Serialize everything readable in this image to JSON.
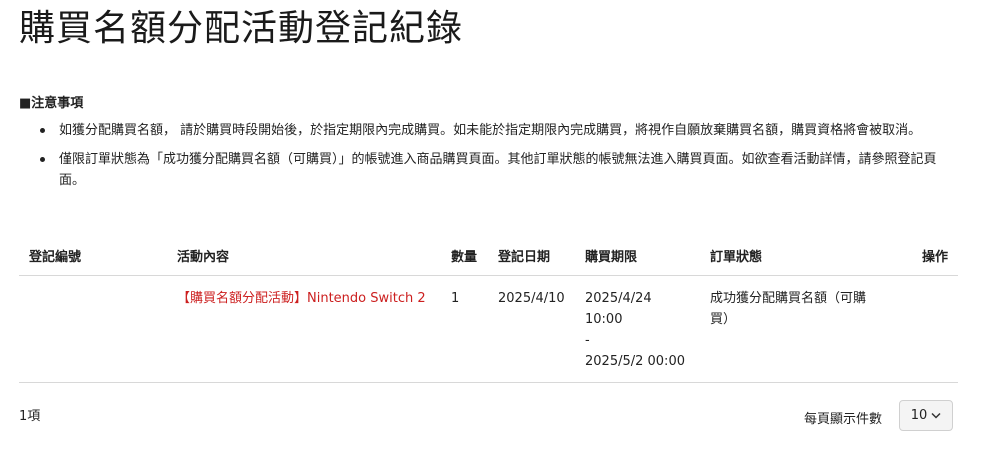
{
  "page": {
    "title": "購買名額分配活動登記紀錄"
  },
  "notes": {
    "heading": "■注意事項",
    "items": [
      "如獲分配購買名額， 請於購買時段開始後，於指定期限內完成購買。如未能於指定期限內完成購買，將視作自願放棄購買名額，購買資格將會被取消。",
      "僅限訂單狀態為「成功獲分配購買名額（可購買）」的帳號進入商品購買頁面。其他訂單狀態的帳號無法進入購買頁面。如欲查看活動詳情，請參照登記頁面。"
    ]
  },
  "table": {
    "headers": {
      "id": "登記編號",
      "activity": "活動內容",
      "quantity": "數量",
      "date": "登記日期",
      "deadline": "購買期限",
      "status": "訂單狀態",
      "action": "操作"
    },
    "rows": [
      {
        "id": "",
        "activity": "【購買名額分配活動】Nintendo Switch 2",
        "quantity": "1",
        "date": "2025/4/10",
        "deadline_start": "2025/4/24 10:00",
        "deadline_sep": "-",
        "deadline_end": "2025/5/2 00:00",
        "status": "成功獲分配購買名額（可購買）",
        "action": ""
      }
    ]
  },
  "footer": {
    "count": "1項",
    "per_page_label": "每頁顯示件數",
    "per_page_value": "10"
  },
  "colors": {
    "activity_link": "#cc1f1f",
    "divider": "#d8d8d8"
  }
}
